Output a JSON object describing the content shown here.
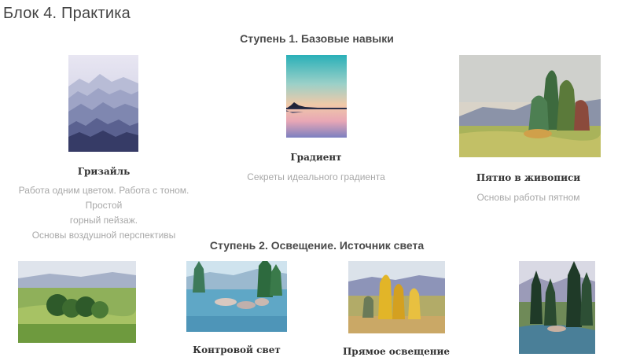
{
  "block": {
    "title": "Блок 4. Практика"
  },
  "steps": [
    {
      "title": "Ступень 1. Базовые навыки",
      "cards": [
        {
          "name": "Гризайль",
          "desc": [
            "Работа одним цветом. Работа с тоном. Простой",
            "горный пейзаж.",
            "Основы воздушной перспективы"
          ]
        },
        {
          "name": "Градиент",
          "desc": [
            "Секреты идеального градиента"
          ]
        },
        {
          "name": "Пятно в живописи",
          "desc": [
            "Основы работы пятном"
          ]
        }
      ]
    },
    {
      "title": "Ступень 2. Освещение. Источник света",
      "cards": [
        {
          "name": ""
        },
        {
          "name": "Контровой свет"
        },
        {
          "name": "Прямое освещение"
        },
        {
          "name": ""
        }
      ]
    }
  ]
}
